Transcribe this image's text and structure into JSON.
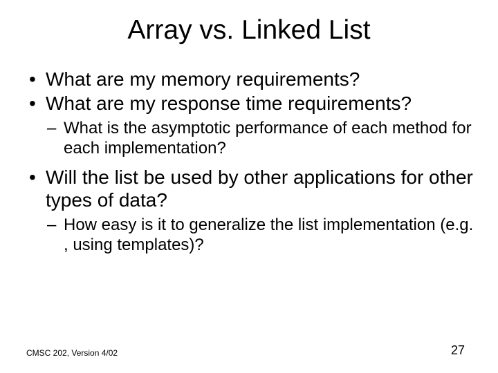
{
  "title": "Array vs. Linked List",
  "bullets": {
    "b1": "What are my memory requirements?",
    "b2": "What are my response time requirements?",
    "b2_1": "What is the asymptotic performance of each method for each implementation?",
    "b3": "Will the list be used by other applications for other types of data?",
    "b3_1": "How easy is it to generalize the list implementation (e.g. , using templates)?"
  },
  "footer": {
    "left": "CMSC 202, Version 4/02",
    "page": "27"
  }
}
